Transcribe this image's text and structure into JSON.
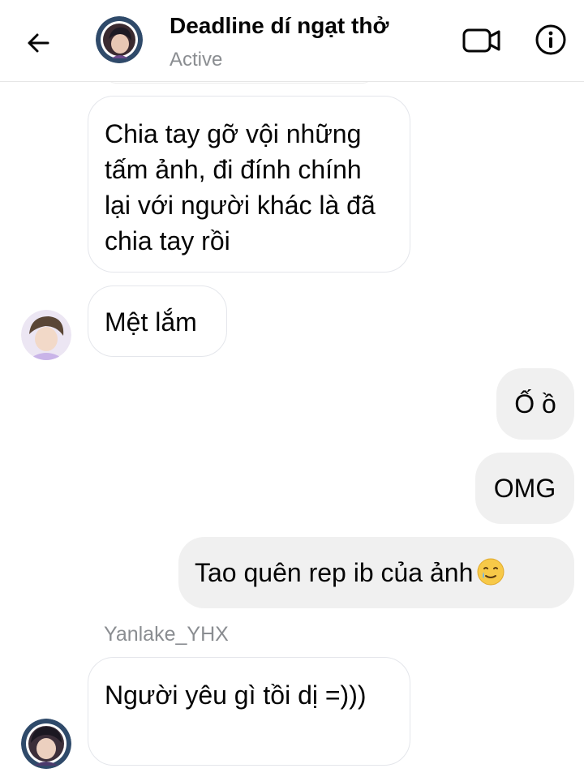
{
  "header": {
    "title": "Deadline dí ngạt thở",
    "status": "Active",
    "icons": {
      "back": "arrow-left-icon",
      "video": "video-camera-icon",
      "info": "info-icon"
    }
  },
  "messages": [
    {
      "side": "incoming",
      "text": "Chia tay gỡ vội những tấm ảnh, đi đính chính lại với người khác là đã chia tay rồi"
    },
    {
      "side": "incoming",
      "text": "Mệt lắm"
    },
    {
      "side": "outgoing",
      "text": "Ố ồ"
    },
    {
      "side": "outgoing",
      "text": "OMG"
    },
    {
      "side": "outgoing",
      "text": "Tao quên rep ib của ảnh",
      "emoji": "smiling-face-with-tear-emoji"
    },
    {
      "side": "incoming",
      "sender": "Yanlake_YHX",
      "text": "Người yêu gì tồi dị =)))"
    }
  ],
  "colors": {
    "outgoing_bubble": "#f0f0f0",
    "incoming_border": "#e4e6eb",
    "secondary_text": "#8a8d91"
  }
}
